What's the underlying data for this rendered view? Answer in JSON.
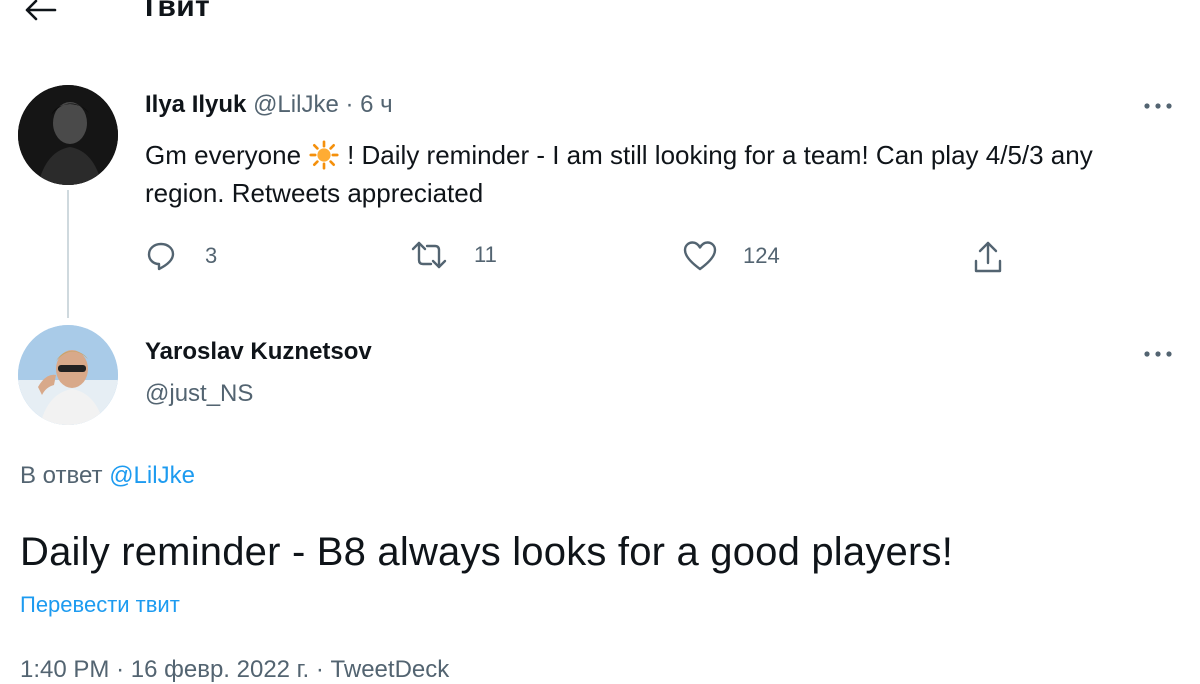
{
  "header": {
    "title": "Твит",
    "back_icon": "arrow-left-icon"
  },
  "original_tweet": {
    "name": "Ilya Ilyuk",
    "handle": "@LilJke",
    "separator": "·",
    "time": "6 ч",
    "text_before_emoji": "Gm everyone",
    "emoji": "sun-icon",
    "text_after_emoji": "! Daily reminder - I am still looking for a team! Can play 4/5/3 any region. Retweets appreciated",
    "replies": "3",
    "retweets": "11",
    "likes": "124"
  },
  "reply_tweet": {
    "name": "Yaroslav Kuznetsov",
    "handle": "@just_NS",
    "reply_prefix": "В ответ",
    "reply_to": "@LilJke",
    "text": "Daily reminder - B8 always looks for a good players!",
    "translate": "Перевести твит",
    "time": "1:40 PM",
    "dot1": "·",
    "date": "16 февр. 2022 г.",
    "dot2": "·",
    "source": "TweetDeck"
  },
  "colors": {
    "accent": "#1d9bf0",
    "muted": "#536471",
    "text": "#0f1419",
    "line": "#cfd9de"
  }
}
